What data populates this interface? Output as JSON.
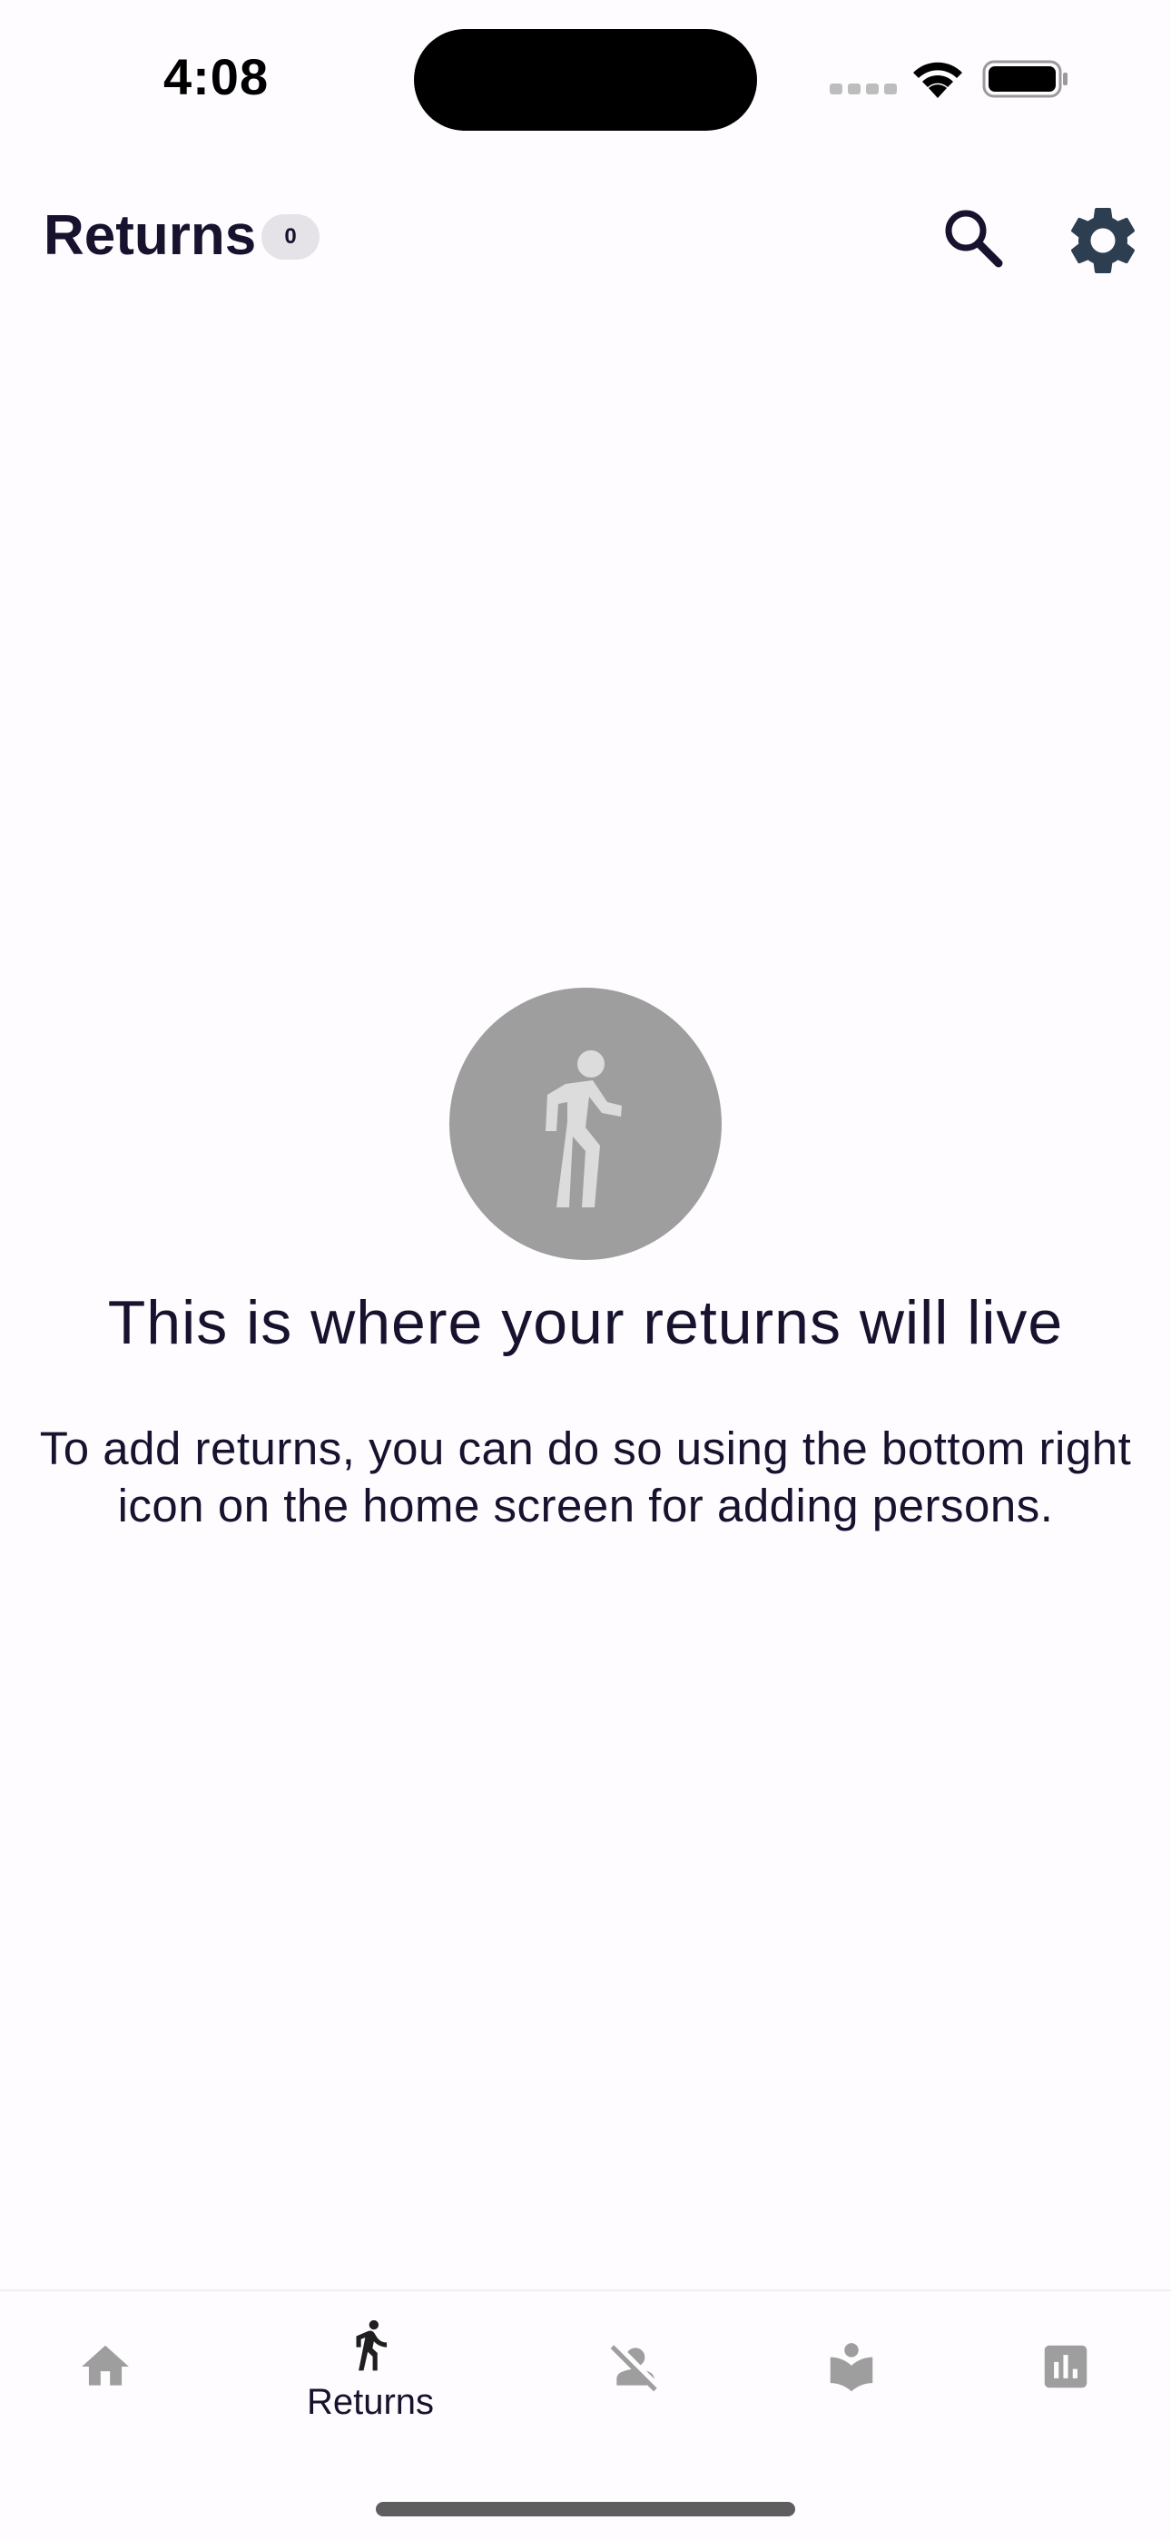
{
  "status_bar": {
    "time": "4:08",
    "wifi_icon": "wifi-icon",
    "battery_icon": "battery-full-icon"
  },
  "header": {
    "title": "Returns",
    "count": "0",
    "search_icon": "search-icon",
    "settings_icon": "gear-icon"
  },
  "empty_state": {
    "icon": "person-walking-icon",
    "title": "This is where your returns will live",
    "description": "To add returns, you can do so using the bottom right icon on the home screen for adding persons."
  },
  "bottom_nav": {
    "items": [
      {
        "icon": "home-icon",
        "label": "",
        "active": false
      },
      {
        "icon": "person-walking-icon",
        "label": "Returns",
        "active": true
      },
      {
        "icon": "person-off-icon",
        "label": "",
        "active": false
      },
      {
        "icon": "book-reader-icon",
        "label": "",
        "active": false
      },
      {
        "icon": "bar-chart-icon",
        "label": "",
        "active": false
      }
    ]
  },
  "colors": {
    "background": "#fefcff",
    "text_primary": "#17122e",
    "inactive_icon": "#9e9e9e",
    "active_icon": "#1f1f1f",
    "settings_icon": "#2c3e50",
    "badge_background": "#e5e3e8"
  }
}
